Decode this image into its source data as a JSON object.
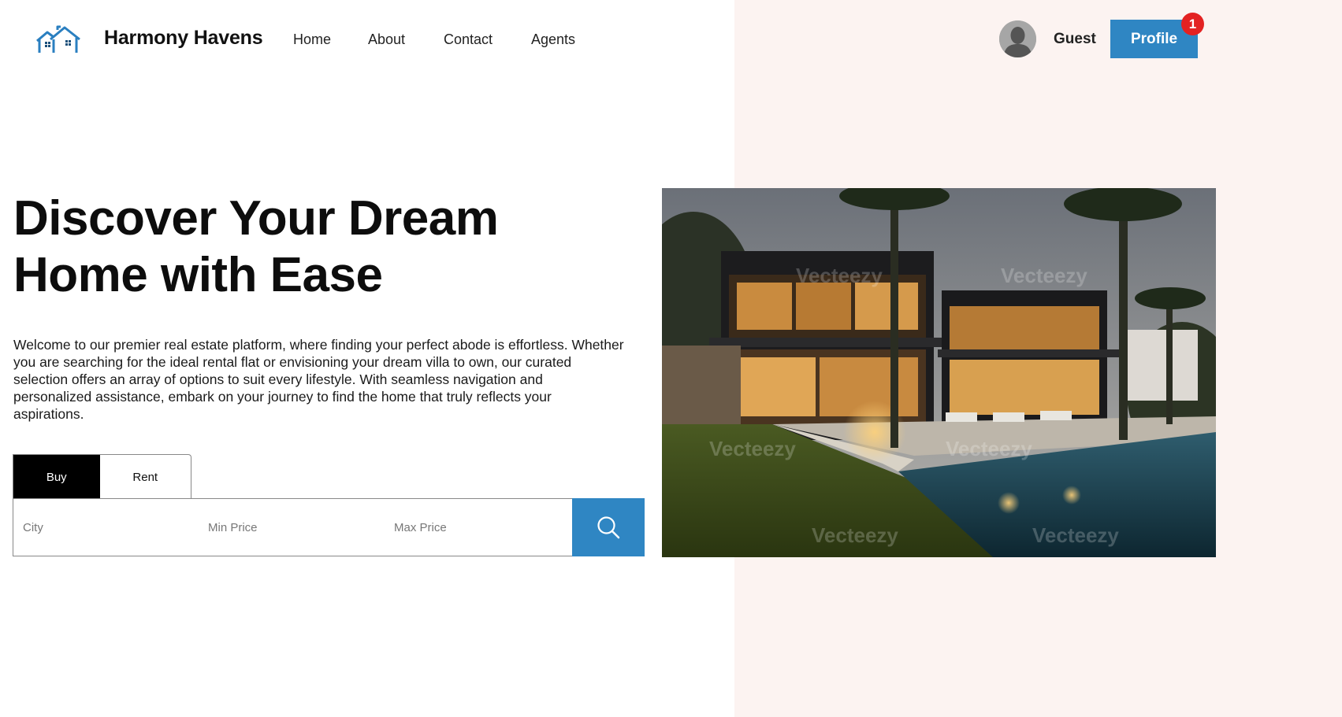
{
  "brand": {
    "name": "Harmony Havens",
    "logo_icon": "house-logo-icon"
  },
  "nav": {
    "items": [
      {
        "label": "Home"
      },
      {
        "label": "About"
      },
      {
        "label": "Contact"
      },
      {
        "label": "Agents"
      }
    ]
  },
  "user": {
    "name": "Guest",
    "avatar_icon": "user-avatar-icon",
    "profile_label": "Profile",
    "notification_count": "1"
  },
  "hero": {
    "title": "Discover Your Dream Home with Ease",
    "description": "Welcome to our premier real estate platform, where finding your perfect abode is effortless. Whether you are searching for the ideal rental flat or envisioning your dream villa to own, our curated selection offers an array of options to suit every lifestyle. With seamless navigation and personalized assistance, embark on your journey to find the home that truly reflects your aspirations."
  },
  "search": {
    "tabs": [
      {
        "label": "Buy",
        "active": true
      },
      {
        "label": "Rent",
        "active": false
      }
    ],
    "city_placeholder": "City",
    "min_price_placeholder": "Min Price",
    "max_price_placeholder": "Max Price",
    "button_icon": "search-icon"
  },
  "image": {
    "watermark": "Vecteezy"
  },
  "colors": {
    "accent": "#2f86c3",
    "badge": "#e32222",
    "panel": "#fcf3f1",
    "active_tab": "#000000"
  }
}
